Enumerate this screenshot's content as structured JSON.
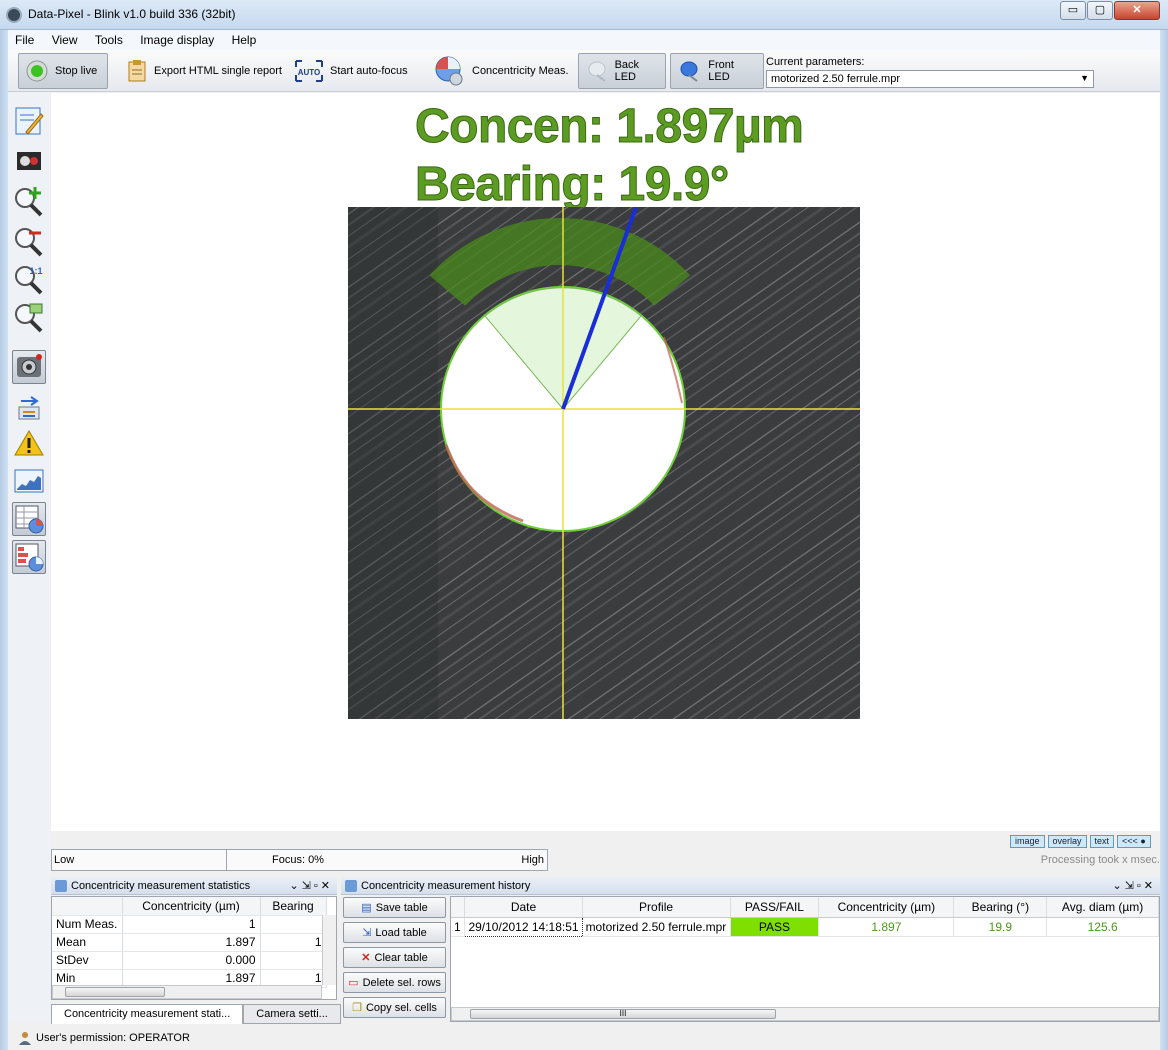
{
  "window": {
    "title": "Data-Pixel - Blink v1.0 build 336 (32bit)",
    "min": "▭",
    "max": "▢",
    "close": "✕"
  },
  "menu": [
    "File",
    "View",
    "Tools",
    "Image display",
    "Help"
  ],
  "toolbar": {
    "stop_live": "Stop live",
    "export_html": "Export HTML single report",
    "auto_badge": "AUTO",
    "autofocus": "Start auto-focus",
    "concentricity": "Concentricity Meas.",
    "back_led": "Back LED",
    "front_led": "Front LED",
    "params_label": "Current parameters:",
    "params_value": "motorized 2.50 ferrule.mpr"
  },
  "overlay": {
    "concen": "Concen: 1.897µm",
    "bearing": "Bearing: 19.9°",
    "bearing_deg": 19.9
  },
  "view_buttons": [
    "image",
    "overlay",
    "text",
    "<<< ●"
  ],
  "focus": {
    "low": "Low",
    "label": "Focus: 0%",
    "high": "High"
  },
  "processing": "Processing took x msec.",
  "stats_panel": {
    "title": "Concentricity measurement statistics",
    "headers": [
      "",
      "Concentricity (µm)",
      "Bearing"
    ],
    "rows": [
      [
        "Num Meas.",
        "1",
        ""
      ],
      [
        "Mean",
        "1.897",
        "1"
      ],
      [
        "StDev",
        "0.000",
        ""
      ],
      [
        "Min",
        "1.897",
        "1"
      ]
    ]
  },
  "tabs": [
    "Concentricity measurement stati...",
    "Camera setti..."
  ],
  "history_panel": {
    "title": "Concentricity measurement history",
    "buttons": [
      "Save table",
      "Load table",
      "Clear table",
      "Delete sel. rows",
      "Copy sel. cells"
    ],
    "headers": [
      "",
      "Date",
      "Profile",
      "PASS/FAIL",
      "Concentricity (µm)",
      "Bearing (°)",
      "Avg. diam (µm)"
    ],
    "rows": [
      [
        "1",
        "29/10/2012 14:18:51",
        "motorized 2.50 ferrule.mpr",
        "PASS",
        "1.897",
        "19.9",
        "125.6"
      ]
    ],
    "scroll_mark": "III"
  },
  "status": "User's permission: OPERATOR",
  "colors": {
    "pass": "#7fe000",
    "accent_green": "#5d9c22",
    "bearing_line": "#1a2ed8"
  }
}
